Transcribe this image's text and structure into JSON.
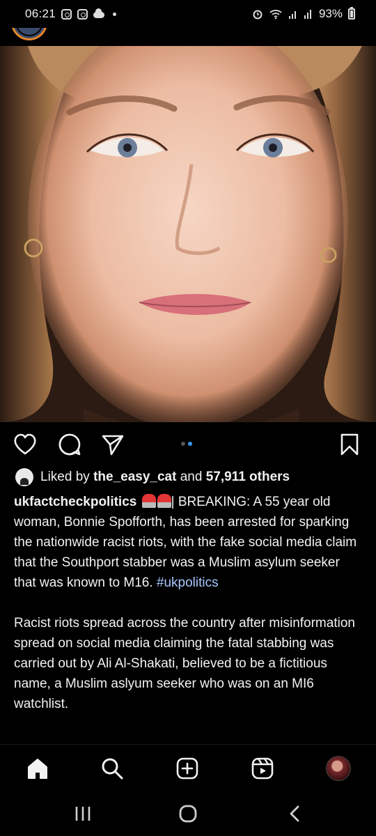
{
  "status_bar": {
    "time": "06:21",
    "battery": "93%",
    "icons": [
      "instagram-icon",
      "instagram-icon",
      "cloud-icon",
      "dot-icon",
      "alarm-icon",
      "wifi-icon",
      "signal-icon",
      "signal-r-icon",
      "battery-icon"
    ]
  },
  "post": {
    "image_description_icon": "portrait-photo",
    "carousel": {
      "count": 2,
      "active_index": 1
    },
    "actions": [
      "heart-icon",
      "comment-icon",
      "share-icon",
      "bookmark-icon"
    ]
  },
  "likes": {
    "prefix": "Liked by",
    "user": "the_easy_cat",
    "middle": "and",
    "others": "57,911 others"
  },
  "caption": {
    "username": "ukfactcheckpolitics",
    "text1": "| BREAKING: A 55 year old woman, Bonnie Spofforth, has been arrested for sparking the nationwide racist riots, with the fake social media claim that the Southport stabber was a Muslim asylum seeker that was known to M16.",
    "hashtag": "#ukpolitics",
    "text2": "Racist riots spread across the country after misinformation spread on social media claiming the fatal stabbing was carried out by Ali Al-Shakati, believed to be a fictitious name, a Muslim aslyum seeker who was on an MI6 watchlist."
  },
  "bottom_nav": [
    "home-icon",
    "search-icon",
    "create-post-icon",
    "reels-icon",
    "profile-avatar"
  ],
  "system_nav": [
    "recents-icon",
    "home-circle-icon",
    "back-icon"
  ],
  "colors": {
    "accent_blue": "#3897f0",
    "hashtag": "#a6c7ff",
    "background": "#000000"
  }
}
